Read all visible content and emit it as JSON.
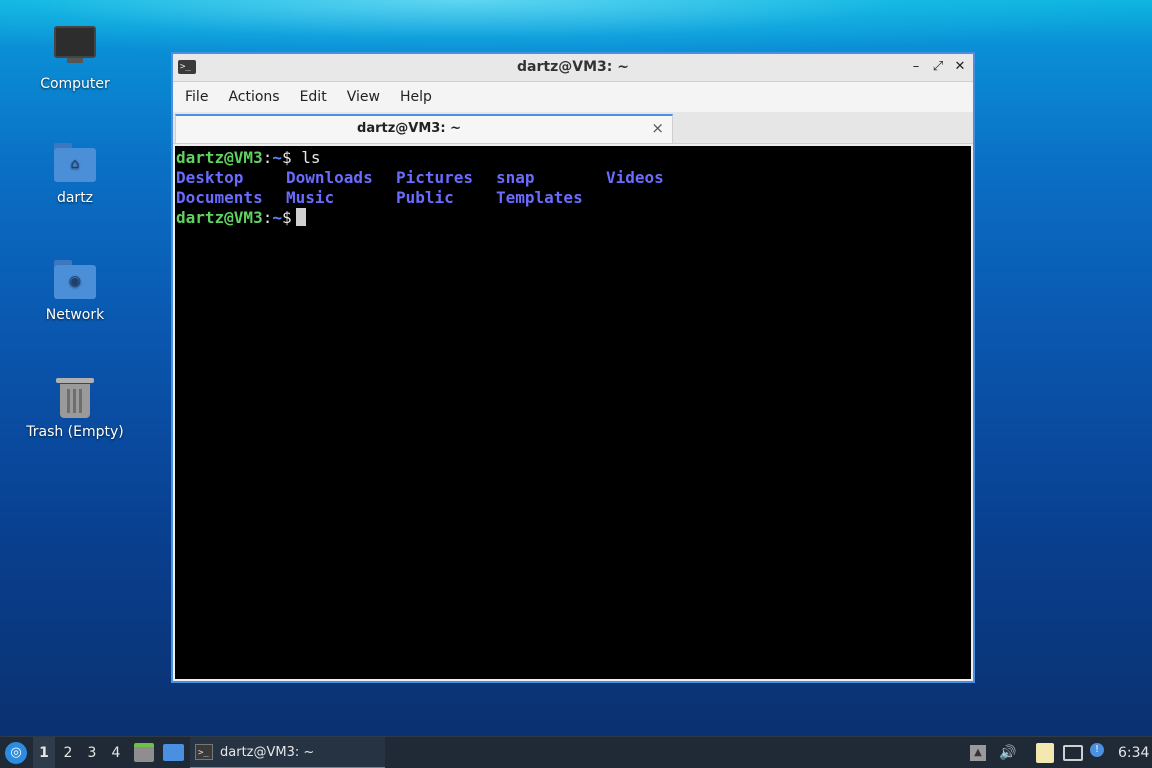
{
  "desktop": {
    "icons": [
      {
        "label": "Computer"
      },
      {
        "label": "dartz"
      },
      {
        "label": "Network"
      },
      {
        "label": "Trash (Empty)"
      }
    ]
  },
  "window": {
    "title": "dartz@VM3: ~",
    "menu": [
      "File",
      "Actions",
      "Edit",
      "View",
      "Help"
    ],
    "tab_label": "dartz@VM3: ~",
    "tab_close": "×",
    "buttons": {
      "minimize": "–",
      "maximize": "⤢",
      "close": "✕"
    }
  },
  "terminal": {
    "prompt_user": "dartz@VM3",
    "prompt_sep": ":",
    "prompt_path": "~",
    "prompt_symbol": "$",
    "command": "ls",
    "listing_row1": [
      "Desktop",
      "Downloads",
      "Pictures",
      "snap",
      "Videos"
    ],
    "listing_row2": [
      "Documents",
      "Music",
      "Public",
      "Templates"
    ]
  },
  "taskbar": {
    "workspaces": [
      "1",
      "2",
      "3",
      "4"
    ],
    "active_workspace": "1",
    "task_label": "dartz@VM3: ~",
    "clock": "6:34"
  },
  "colors": {
    "accent": "#4a8fe0",
    "prompt_user": "#5fd35f",
    "directory": "#6b6bff"
  }
}
